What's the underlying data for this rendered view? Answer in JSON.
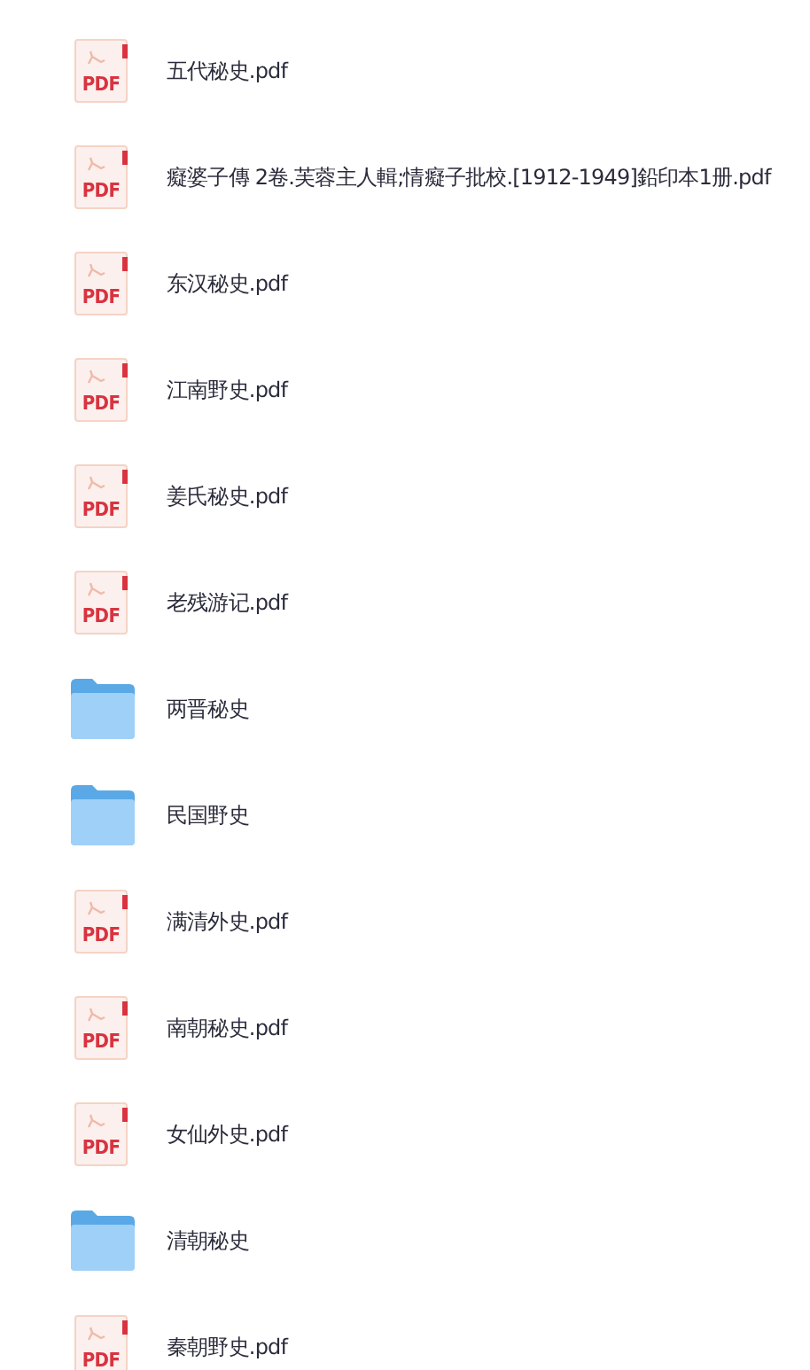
{
  "files": [
    {
      "kind": "pdf",
      "name": "五代秘史.pdf",
      "badge": "PDF"
    },
    {
      "kind": "pdf",
      "name": "癡婆子傳 2卷.芙蓉主人輯;情癡子批校.[1912-1949]鉛印本1册.pdf",
      "badge": "PDF"
    },
    {
      "kind": "pdf",
      "name": "东汉秘史.pdf",
      "badge": "PDF"
    },
    {
      "kind": "pdf",
      "name": "江南野史.pdf",
      "badge": "PDF"
    },
    {
      "kind": "pdf",
      "name": "姜氏秘史.pdf",
      "badge": "PDF"
    },
    {
      "kind": "pdf",
      "name": "老残游记.pdf",
      "badge": "PDF"
    },
    {
      "kind": "folder",
      "name": "两晋秘史"
    },
    {
      "kind": "folder",
      "name": "民国野史"
    },
    {
      "kind": "pdf",
      "name": "满清外史.pdf",
      "badge": "PDF"
    },
    {
      "kind": "pdf",
      "name": "南朝秘史.pdf",
      "badge": "PDF"
    },
    {
      "kind": "pdf",
      "name": "女仙外史.pdf",
      "badge": "PDF"
    },
    {
      "kind": "folder",
      "name": "清朝秘史"
    },
    {
      "kind": "pdf",
      "name": "秦朝野史.pdf",
      "badge": "PDF"
    }
  ]
}
